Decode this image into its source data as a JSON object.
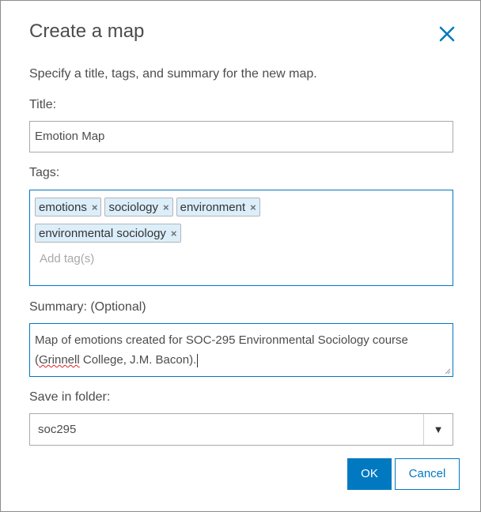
{
  "dialog": {
    "title": "Create a map",
    "close_icon": "close-icon",
    "description": "Specify a title, tags, and summary for the new map."
  },
  "title_field": {
    "label": "Title:",
    "value": "Emotion Map"
  },
  "tags_field": {
    "label": "Tags:",
    "tags": [
      "emotions",
      "sociology",
      "environment",
      "environmental sociology"
    ],
    "remove_glyph": "×",
    "placeholder": "Add tag(s)"
  },
  "summary_field": {
    "label": "Summary: (Optional)",
    "value_line1": "Map of emotions created for SOC-295 Environmental Sociology course",
    "value_line2_word1": "Grinnell",
    "value_line2_rest": " College, J.M. Bacon).",
    "value_line2_open": "("
  },
  "folder_field": {
    "label": "Save in folder:",
    "value": "soc295",
    "arrow_glyph": "▼"
  },
  "buttons": {
    "ok": "OK",
    "cancel": "Cancel"
  },
  "colors": {
    "accent": "#0079c1",
    "tag_background": "#dceefa",
    "text": "#4c4c4c"
  }
}
